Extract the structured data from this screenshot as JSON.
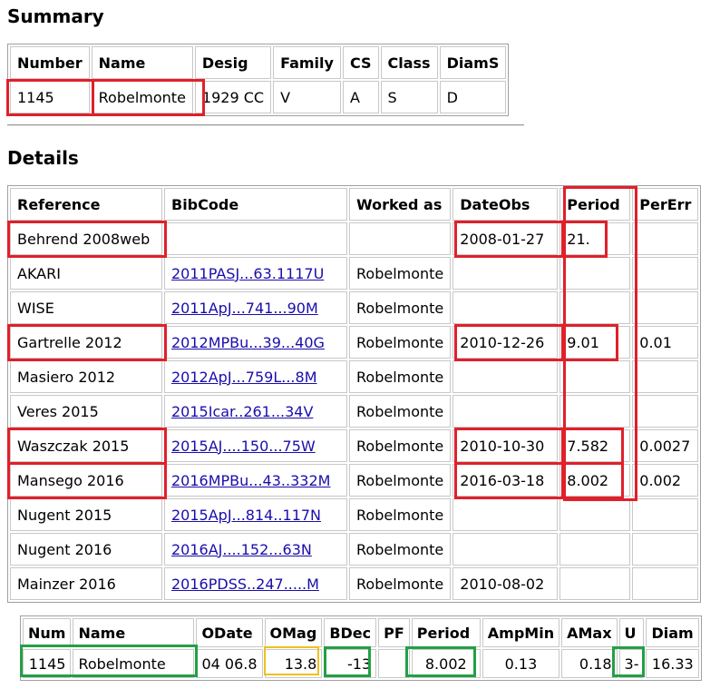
{
  "summary": {
    "heading": "Summary",
    "headers": [
      "Number",
      "Name",
      "Desig",
      "Family",
      "CS",
      "Class",
      "DiamS"
    ],
    "row": [
      "1145",
      "Robelmonte",
      "1929 CC",
      "V",
      "A",
      "S",
      "D"
    ]
  },
  "details": {
    "heading": "Details",
    "headers": [
      "Reference",
      "BibCode",
      "Worked as",
      "DateObs",
      "Period",
      "PerErr"
    ],
    "rows": [
      {
        "ref": "Behrend 2008web",
        "bib": "",
        "worked": "",
        "date": "2008-01-27",
        "period": "21.",
        "err": ""
      },
      {
        "ref": "AKARI",
        "bib": "2011PASJ...63.1117U",
        "worked": "Robelmonte",
        "date": "",
        "period": "",
        "err": ""
      },
      {
        "ref": "WISE",
        "bib": "2011ApJ...741...90M",
        "worked": "Robelmonte",
        "date": "",
        "period": "",
        "err": ""
      },
      {
        "ref": "Gartrelle 2012",
        "bib": "2012MPBu...39...40G",
        "worked": "Robelmonte",
        "date": "2010-12-26",
        "period": "9.01",
        "err": "0.01"
      },
      {
        "ref": "Masiero 2012",
        "bib": "2012ApJ...759L...8M",
        "worked": "Robelmonte",
        "date": "",
        "period": "",
        "err": ""
      },
      {
        "ref": "Veres 2015",
        "bib": "2015Icar..261...34V",
        "worked": "Robelmonte",
        "date": "",
        "period": "",
        "err": ""
      },
      {
        "ref": "Waszczak 2015",
        "bib": "2015AJ....150...75W",
        "worked": "Robelmonte",
        "date": "2010-10-30",
        "period": "7.582",
        "err": "0.0027"
      },
      {
        "ref": "Mansego 2016",
        "bib": "2016MPBu...43..332M",
        "worked": "Robelmonte",
        "date": "2016-03-18",
        "period": "8.002",
        "err": "0.002"
      },
      {
        "ref": "Nugent 2015",
        "bib": "2015ApJ...814..117N",
        "worked": "Robelmonte",
        "date": "",
        "period": "",
        "err": ""
      },
      {
        "ref": "Nugent 2016",
        "bib": "2016AJ....152...63N",
        "worked": "Robelmonte",
        "date": "",
        "period": "",
        "err": ""
      },
      {
        "ref": "Mainzer 2016",
        "bib": "2016PDSS..247.....M",
        "worked": "Robelmonte",
        "date": "2010-08-02",
        "period": "",
        "err": ""
      }
    ]
  },
  "bottom": {
    "headers": [
      "Num",
      "Name",
      "ODate",
      "OMag",
      "BDec",
      "PF",
      "Period",
      "AmpMin",
      "AMax",
      "U",
      "Diam"
    ],
    "row": [
      "1145",
      "Robelmonte",
      "04 06.8",
      "13.8",
      "-13",
      "",
      "8.002",
      "0.13",
      "0.18",
      "3-",
      "16.33"
    ]
  },
  "colors": {
    "highlight_red": "#e0202a",
    "highlight_green": "#22a045",
    "highlight_yellow": "#f0c020",
    "link": "#1a0dab"
  }
}
